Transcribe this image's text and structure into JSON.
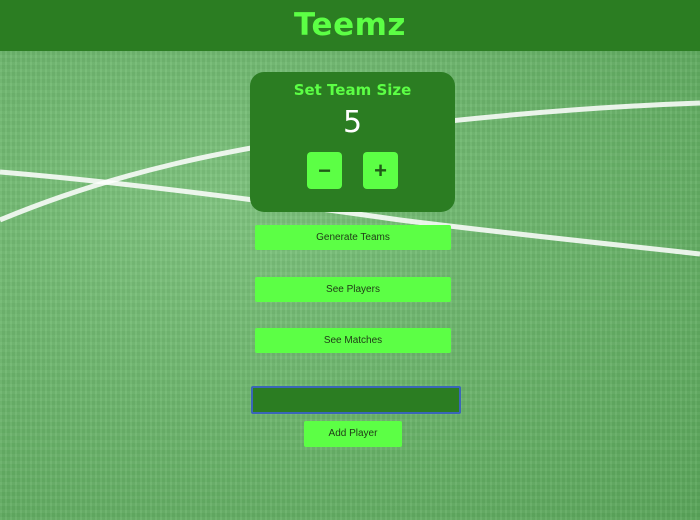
{
  "header": {
    "title": "Teemz"
  },
  "team_size": {
    "title": "Set Team Size",
    "value": "5",
    "decrement_label": "−",
    "increment_label": "+"
  },
  "actions": {
    "generate_label": "Generate Teams",
    "players_label": "See Players",
    "matches_label": "See Matches"
  },
  "player_form": {
    "input_value": "",
    "input_placeholder": "",
    "add_label": "Add Player"
  },
  "colors": {
    "header_bg": "#2b7d22",
    "accent": "#5cff45",
    "field": "#6db66d",
    "focus_border": "#3a66b8"
  }
}
